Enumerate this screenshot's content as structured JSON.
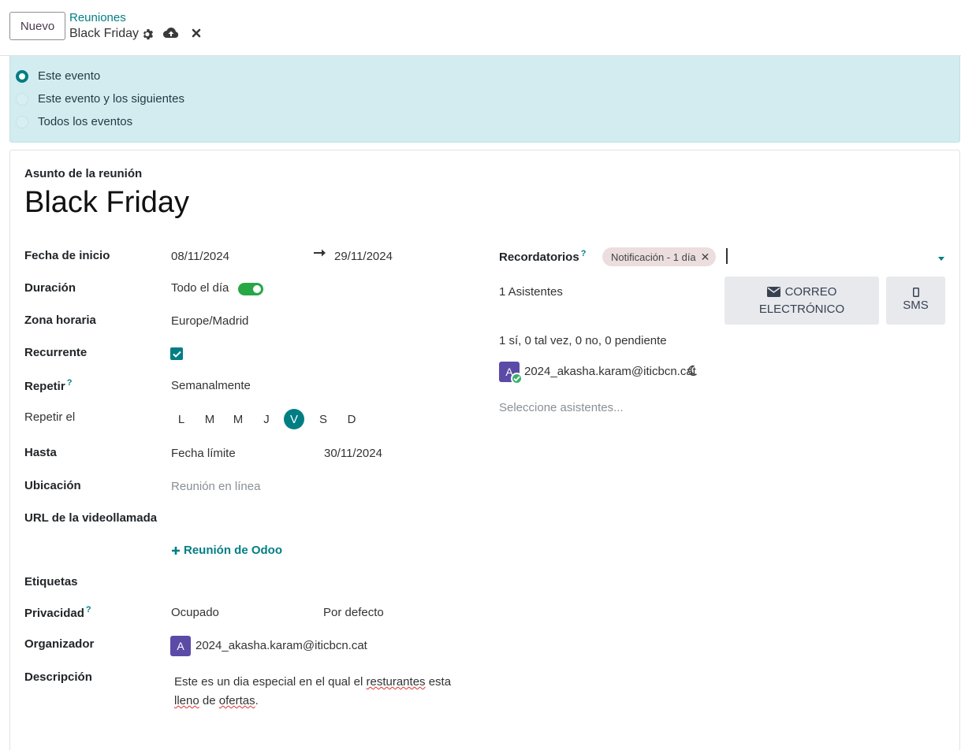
{
  "header": {
    "new_button": "Nuevo",
    "breadcrumb_parent": "Reuniones",
    "breadcrumb_current": "Black Friday"
  },
  "recurrence_update": {
    "options": [
      "Este evento",
      "Este evento y los siguientes",
      "Todos los eventos"
    ],
    "selected": "Este evento"
  },
  "form": {
    "subject_label": "Asunto de la reunión",
    "subject": "Black Friday",
    "start_label": "Fecha de inicio",
    "start_date": "08/11/2024",
    "end_date": "29/11/2024",
    "duration_label": "Duración",
    "all_day_label": "Todo el día",
    "all_day": true,
    "timezone_label": "Zona horaria",
    "timezone": "Europe/Madrid",
    "recurrent_label": "Recurrente",
    "recurrent": true,
    "repeat_label": "Repetir",
    "repeat_help": "?",
    "repeat_value": "Semanalmente",
    "repeat_on_label": "Repetir el",
    "weekdays": [
      "L",
      "M",
      "M",
      "J",
      "V",
      "S",
      "D"
    ],
    "selected_weekday": "V",
    "until_label": "Hasta",
    "until_type": "Fecha límite",
    "until_date": "30/11/2024",
    "location_label": "Ubicación",
    "location_placeholder": "Reunión en línea",
    "video_label": "URL de la videollamada",
    "odoo_meeting_link": "Reunión de Odoo",
    "tags_label": "Etiquetas",
    "privacy_label": "Privacidad",
    "privacy_help": "?",
    "privacy_show_as": "Ocupado",
    "privacy_value": "Por defecto",
    "organizer_label": "Organizador",
    "organizer_initial": "A",
    "organizer": "2024_akasha.karam@iticbcn.cat",
    "description_label": "Descripción",
    "description": {
      "p1": "Este es un dia especial en el qual el ",
      "w1": "resturantes",
      "p2": " esta ",
      "w2": "lleno",
      "p3": " de ",
      "w3": "ofertas",
      "p4": "."
    }
  },
  "right": {
    "reminders_label": "Recordatorios",
    "reminders_help": "?",
    "reminder_tag": "Notificación - 1 día",
    "attendees_count": "1 Asistentes",
    "email_button_line1": "CORREO",
    "email_button_line2": "ELECTRÓNICO",
    "sms_button": "SMS",
    "attendance_summary": "1 sí, 0 tal vez, 0 no, 0 pendiente",
    "attendee_initial": "A",
    "attendee_email": "2024_akasha.karam@iticbcn.cat",
    "attendees_placeholder": "Seleccione asistentes..."
  },
  "colors": {
    "primary": "#017e84",
    "alert_bg": "#d3ecf0",
    "toggle_on": "#28a745",
    "avatar": "#5b4ba6",
    "tag_bg": "#ecdede",
    "accepted": "#38b26a"
  }
}
